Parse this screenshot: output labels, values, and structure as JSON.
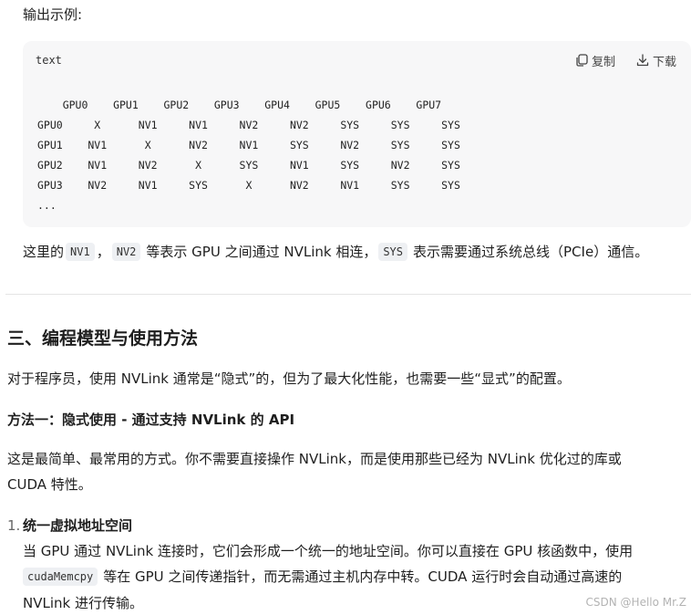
{
  "intro_label": "输出示例:",
  "code": {
    "language": "text",
    "copy_label": "复制",
    "download_label": "下载",
    "body": "    GPU0    GPU1    GPU2    GPU3    GPU4    GPU5    GPU6    GPU7\nGPU0     X      NV1     NV1     NV2     NV2     SYS     SYS     SYS\nGPU1    NV1      X      NV2     NV1     SYS     NV2     SYS     SYS\nGPU2    NV1     NV2      X      SYS     NV1     SYS     NV2     SYS\nGPU3    NV2     NV1     SYS      X      NV2     NV1     SYS     SYS\n..."
  },
  "explain": {
    "pre": "这里的",
    "nv1": "NV1",
    "sep": "，",
    "nv2": "NV2",
    "mid": "等表示 GPU 之间通过 NVLink 相连，",
    "sys": "SYS",
    "post": "表示需要通过系统总线（PCIe）通信。"
  },
  "section_title": "三、编程模型与使用方法",
  "para1": "对于程序员，使用 NVLink 通常是“隐式”的，但为了最大化性能，也需要一些“显式”的配置。",
  "method_title": "方法一：隐式使用 - 通过支持 NVLink 的 API",
  "para2_line1": "这是最简单、最常用的方式。你不需要直接操作 NVLink，而是使用那些已经为 NVLink 优化过的库或",
  "para2_line2": "CUDA 特性。",
  "list_item": {
    "number": "1.",
    "title": "统一虚拟地址空间",
    "line1": "当 GPU 通过 NVLink 连接时，它们会形成一个统一的地址空间。你可以直接在 GPU 核函数中，使用",
    "code": "cudaMemcpy",
    "line2_rest": "等在 GPU 之间传递指针，而无需通过主机内存中转。CUDA 运行时会自动通过高速的",
    "line3": "NVLink 进行传输。"
  },
  "watermark": "CSDN @Hello Mr.Z"
}
